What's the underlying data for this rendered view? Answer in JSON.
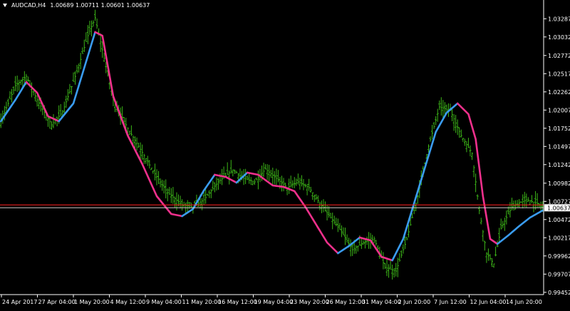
{
  "header": {
    "symbol": "AUDCAD,H4",
    "ohlc": "1.00689 1.00711 1.00601 1.00637"
  },
  "colors": {
    "background": "#000000",
    "bars": "#3cb418",
    "ma_up": "#3a9cf0",
    "ma_down": "#f0308c",
    "price_line": "#ff2020",
    "ask_line": "#c8c8c8",
    "axis": "#ffffff"
  },
  "icons": {
    "menu": "triangle-down-icon"
  },
  "chart_data": {
    "type": "ohlc",
    "y_ticks": [
      "1.03287",
      "1.03032",
      "1.02772",
      "1.02517",
      "1.02262",
      "1.02007",
      "1.01752",
      "1.01497",
      "1.01242",
      "1.00982",
      "1.00727",
      "1.00472",
      "1.00217",
      "0.99962",
      "0.99707",
      "0.99452"
    ],
    "ylim": [
      0.9942,
      1.0355
    ],
    "current_price": "1.00637",
    "x_ticks": [
      "24 Apr 2017",
      "27 Apr 04:00",
      "1 May 20:00",
      "4 May 12:00",
      "9 May 04:00",
      "11 May 20:00",
      "16 May 12:00",
      "19 May 04:00",
      "23 May 20:00",
      "26 May 12:00",
      "31 May 04:00",
      "2 Jun 20:00",
      "7 Jun 12:00",
      "12 Jun 04:00",
      "14 Jun 20:00"
    ],
    "price_path": [
      [
        0,
        1.0185
      ],
      [
        8,
        1.0235
      ],
      [
        14,
        1.0248
      ],
      [
        20,
        1.0215
      ],
      [
        28,
        1.018
      ],
      [
        34,
        1.0198
      ],
      [
        42,
        1.0255
      ],
      [
        48,
        1.0305
      ],
      [
        52,
        1.033
      ],
      [
        56,
        1.0285
      ],
      [
        62,
        1.0215
      ],
      [
        70,
        1.0175
      ],
      [
        76,
        1.015
      ],
      [
        84,
        1.0115
      ],
      [
        92,
        1.0085
      ],
      [
        100,
        1.0068
      ],
      [
        106,
        1.0065
      ],
      [
        112,
        1.0075
      ],
      [
        120,
        1.01
      ],
      [
        128,
        1.0117
      ],
      [
        134,
        1.0105
      ],
      [
        140,
        1.01
      ],
      [
        146,
        1.0118
      ],
      [
        152,
        1.0105
      ],
      [
        158,
        1.0092
      ],
      [
        164,
        1.01
      ],
      [
        170,
        1.0092
      ],
      [
        176,
        1.007
      ],
      [
        182,
        1.005
      ],
      [
        188,
        1.003
      ],
      [
        194,
        1.0005
      ],
      [
        200,
        1.0015
      ],
      [
        206,
        1.002
      ],
      [
        212,
        0.998
      ],
      [
        218,
        0.9975
      ],
      [
        224,
        1.002
      ],
      [
        230,
        1.008
      ],
      [
        236,
        1.015
      ],
      [
        242,
        1.0205
      ],
      [
        248,
        1.02
      ],
      [
        254,
        1.0165
      ],
      [
        260,
        1.014
      ],
      [
        264,
        1.006
      ],
      [
        268,
        1.0
      ],
      [
        272,
        0.9985
      ],
      [
        276,
        1.0035
      ],
      [
        282,
        1.0065
      ],
      [
        290,
        1.0075
      ],
      [
        296,
        1.007
      ],
      [
        299,
        1.0064
      ]
    ],
    "ma_path": [
      [
        0,
        1.0185
      ],
      [
        8,
        1.0215
      ],
      [
        14,
        1.024
      ],
      [
        20,
        1.0225
      ],
      [
        26,
        1.0192
      ],
      [
        32,
        1.0185
      ],
      [
        40,
        1.021
      ],
      [
        46,
        1.026
      ],
      [
        52,
        1.031
      ],
      [
        56,
        1.0305
      ],
      [
        62,
        1.022
      ],
      [
        70,
        1.0165
      ],
      [
        78,
        1.0125
      ],
      [
        86,
        1.008
      ],
      [
        94,
        1.0055
      ],
      [
        100,
        1.0052
      ],
      [
        106,
        1.0062
      ],
      [
        112,
        1.0088
      ],
      [
        118,
        1.011
      ],
      [
        124,
        1.0107
      ],
      [
        130,
        1.0099
      ],
      [
        136,
        1.0113
      ],
      [
        142,
        1.011
      ],
      [
        150,
        1.0095
      ],
      [
        156,
        1.0093
      ],
      [
        162,
        1.0087
      ],
      [
        168,
        1.0065
      ],
      [
        174,
        1.004
      ],
      [
        180,
        1.0015
      ],
      [
        186,
        1.0
      ],
      [
        192,
        1.001
      ],
      [
        198,
        1.0022
      ],
      [
        204,
        1.0018
      ],
      [
        210,
        0.9995
      ],
      [
        216,
        0.999
      ],
      [
        222,
        1.002
      ],
      [
        228,
        1.007
      ],
      [
        234,
        1.012
      ],
      [
        240,
        1.017
      ],
      [
        246,
        1.0197
      ],
      [
        252,
        1.021
      ],
      [
        258,
        1.0195
      ],
      [
        262,
        1.016
      ],
      [
        266,
        1.008
      ],
      [
        270,
        1.002
      ],
      [
        274,
        1.0013
      ],
      [
        280,
        1.0025
      ],
      [
        286,
        1.0038
      ],
      [
        292,
        1.005
      ],
      [
        299,
        1.006
      ]
    ]
  }
}
